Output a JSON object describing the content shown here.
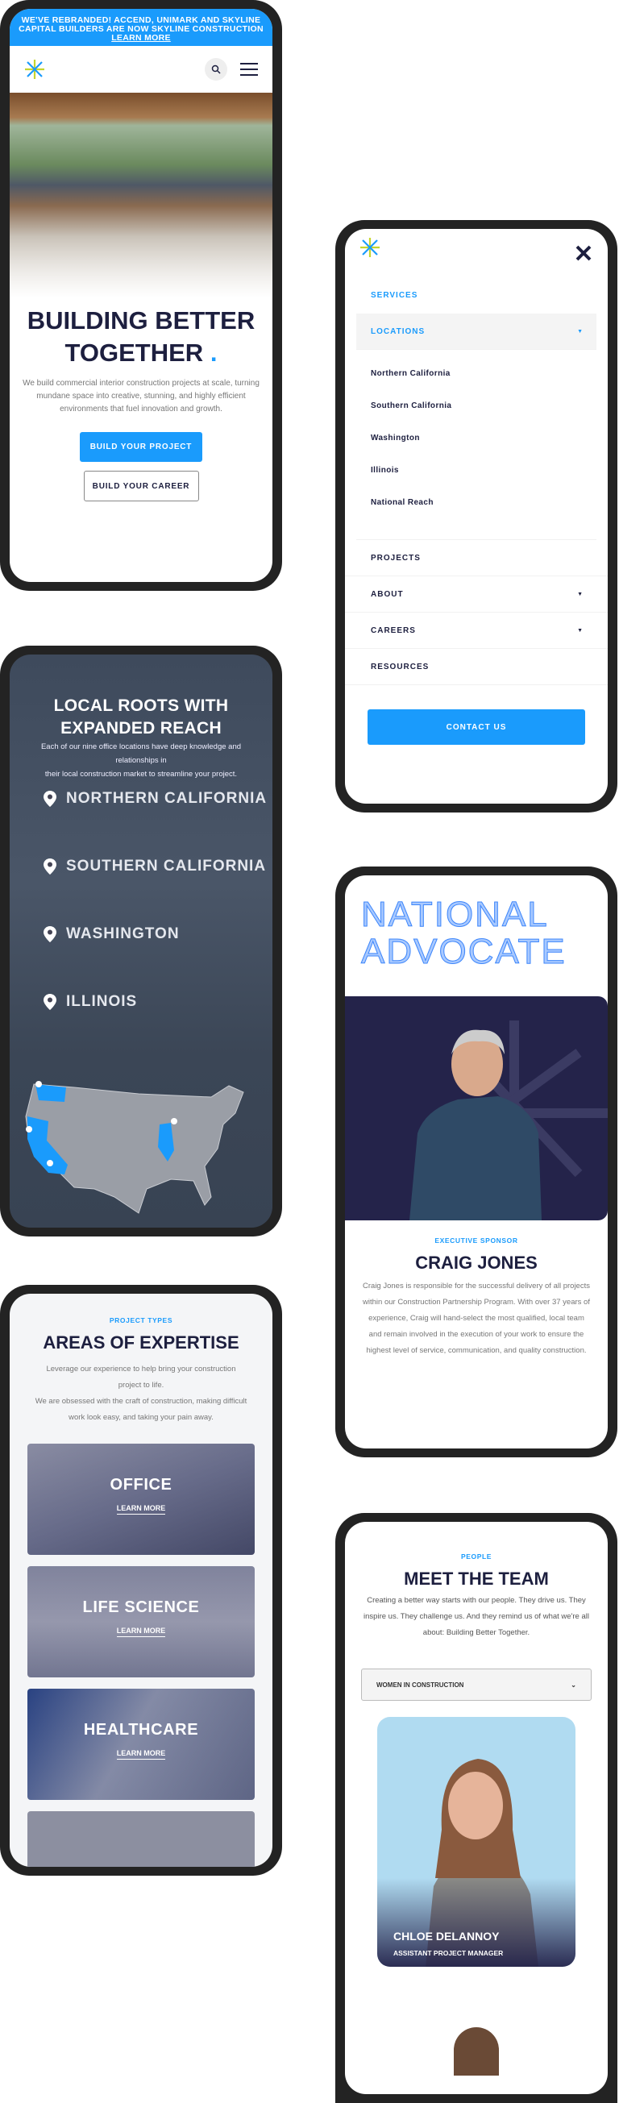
{
  "colors": {
    "brand_blue": "#1a9bfc",
    "navy": "#1d1f3f",
    "logo_green": "#c5d62e",
    "frame": "#232323"
  },
  "home": {
    "banner_text": "WE'VE REBRANDED! ACCEND, UNIMARK AND SKYLINE CAPITAL BUILDERS ARE NOW SKYLINE CONSTRUCTION",
    "banner_link": "LEARN MORE",
    "title_line1": "BUILDING BETTER",
    "title_line2": "TOGETHER",
    "title_dot": ".",
    "intro": "We build commercial interior construction projects at scale, turning mundane space into creative, stunning, and highly efficient environments that fuel innovation and growth.",
    "primary_button": "BUILD YOUR PROJECT",
    "secondary_button": "BUILD YOUR CAREER"
  },
  "menu": {
    "items": [
      {
        "label": "SERVICES"
      },
      {
        "label": "LOCATIONS",
        "expanded": true
      },
      {
        "label": "PROJECTS"
      },
      {
        "label": "ABOUT"
      },
      {
        "label": "CAREERS"
      },
      {
        "label": "RESOURCES"
      }
    ],
    "locations": [
      "Northern California",
      "Southern California",
      "Washington",
      "Illinois",
      "National Reach"
    ],
    "contact_button": "CONTACT US"
  },
  "locations_section": {
    "title": "LOCAL ROOTS WITH EXPANDED REACH",
    "text_line1": "Each of our nine office locations have deep knowledge and relationships in",
    "text_line2": "their local construction market to streamline your project.",
    "items": [
      "NORTHERN CALIFORNIA",
      "SOUTHERN CALIFORNIA",
      "WASHINGTON",
      "ILLINOIS"
    ]
  },
  "expertise": {
    "eyebrow": "PROJECT TYPES",
    "title": "AREAS OF EXPERTISE",
    "text_line1": "Leverage our experience to help bring your construction project to life.",
    "text_line2": "We are obsessed with the craft of construction, making difficult work look easy, and taking your pain away.",
    "cards": [
      {
        "title": "OFFICE",
        "link": "LEARN MORE"
      },
      {
        "title": "LIFE SCIENCE",
        "link": "LEARN MORE"
      },
      {
        "title": "HEALTHCARE",
        "link": "LEARN MORE"
      }
    ]
  },
  "advocate": {
    "title_line1": "NATIONAL",
    "title_line2": "ADVOCATE",
    "eyebrow": "EXECUTIVE SPONSOR",
    "name": "CRAIG JONES",
    "bio": "Craig Jones is responsible for the successful delivery of all projects within our Construction Partnership Program. With over 37 years of experience, Craig will hand-select the most qualified, local team and remain involved in the execution of your work to ensure the highest level of service, communication, and quality construction."
  },
  "team": {
    "eyebrow": "PEOPLE",
    "title": "MEET THE TEAM",
    "text": "Creating a better way starts with our people. They drive us. They inspire us. They challenge us. And they remind us of what we're all about: Building Better Together.",
    "filter_value": "WOMEN IN CONSTRUCTION",
    "member_name": "CHLOE DELANNOY",
    "member_role": "ASSISTANT PROJECT MANAGER"
  }
}
